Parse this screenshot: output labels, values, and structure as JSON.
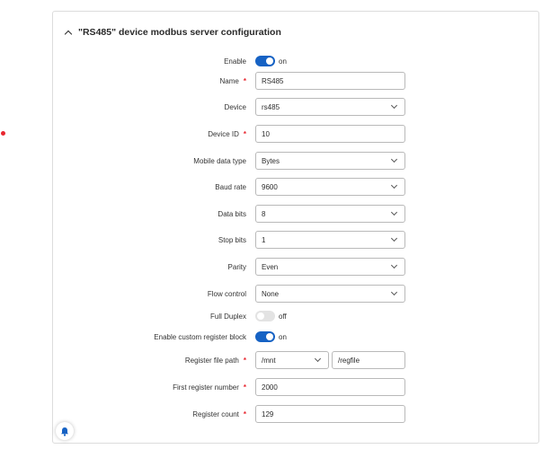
{
  "title": "\"RS485\" device modbus server configuration",
  "colors": {
    "accent": "#1662c4",
    "required": "#e8262f",
    "border": "#b9b9b9"
  },
  "fields": {
    "enable": {
      "label": "Enable",
      "state": "on"
    },
    "name": {
      "label": "Name",
      "value": "RS485"
    },
    "device": {
      "label": "Device",
      "value": "rs485"
    },
    "device_id": {
      "label": "Device ID",
      "value": "10"
    },
    "mobile_data_type": {
      "label": "Mobile data type",
      "value": "Bytes"
    },
    "baud_rate": {
      "label": "Baud rate",
      "value": "9600"
    },
    "data_bits": {
      "label": "Data bits",
      "value": "8"
    },
    "stop_bits": {
      "label": "Stop bits",
      "value": "1"
    },
    "parity": {
      "label": "Parity",
      "value": "Even"
    },
    "flow_control": {
      "label": "Flow control",
      "value": "None"
    },
    "full_duplex": {
      "label": "Full Duplex",
      "state": "off"
    },
    "custom_register_block": {
      "label": "Enable custom register block",
      "state": "on"
    },
    "register_file_path": {
      "label": "Register file path",
      "mount": "/mnt",
      "file": "/regfile"
    },
    "first_register_number": {
      "label": "First register number",
      "value": "2000"
    },
    "register_count": {
      "label": "Register count",
      "value": "129"
    }
  },
  "icons": {
    "collapse": "chevron-up-icon",
    "notifications": "bell-icon"
  }
}
